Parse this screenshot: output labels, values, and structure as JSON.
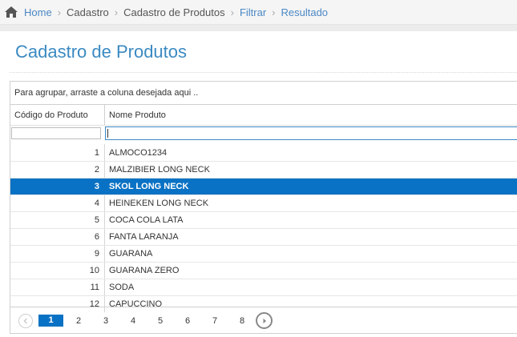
{
  "breadcrumb": {
    "items": [
      {
        "label": "Home",
        "style": "link"
      },
      {
        "label": "Cadastro",
        "style": "dark"
      },
      {
        "label": "Cadastro de Produtos",
        "style": "dark"
      },
      {
        "label": "Filtrar",
        "style": "link"
      },
      {
        "label": "Resultado",
        "style": "link"
      }
    ]
  },
  "page_title": "Cadastro de Produtos",
  "grid": {
    "group_panel_text": "Para agrupar, arraste a coluna desejada aqui ..",
    "columns": [
      "Código do Produto",
      "Nome Produto"
    ],
    "filter": {
      "codigo": "",
      "nome": ""
    },
    "rows": [
      {
        "codigo": "1",
        "nome": "ALMOCO1234"
      },
      {
        "codigo": "2",
        "nome": "MALZIBIER LONG NECK"
      },
      {
        "codigo": "3",
        "nome": "SKOL LONG NECK"
      },
      {
        "codigo": "4",
        "nome": "HEINEKEN LONG NECK"
      },
      {
        "codigo": "5",
        "nome": "COCA COLA LATA"
      },
      {
        "codigo": "6",
        "nome": "FANTA LARANJA"
      },
      {
        "codigo": "9",
        "nome": "GUARANA"
      },
      {
        "codigo": "10",
        "nome": "GUARANA ZERO"
      },
      {
        "codigo": "11",
        "nome": "SODA"
      },
      {
        "codigo": "12",
        "nome": "CAPUCCINO"
      }
    ],
    "selected_row_index": 2
  },
  "pager": {
    "pages": [
      "1",
      "2",
      "3",
      "4",
      "5",
      "6",
      "7",
      "8"
    ],
    "current_page": "1",
    "prev_icon": "chevron-left-icon",
    "next_icon": "chevron-right-icon"
  },
  "colors": {
    "accent": "#0a72c4",
    "title": "#3b8ac2",
    "link": "#4a87c4"
  }
}
